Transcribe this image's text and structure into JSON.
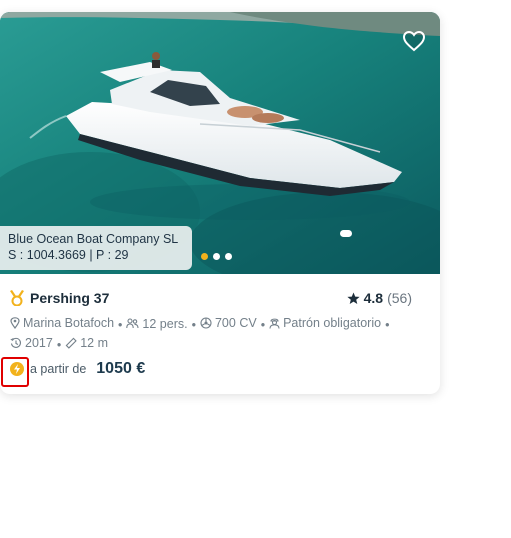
{
  "listing": {
    "company": "Blue Ocean Boat Company SL",
    "company_stats": "S : 1004.3669 | P : 29",
    "boat_name": "Pershing 37",
    "rating": "4.8",
    "rating_count": "(56)",
    "location": "Marina Botafoch",
    "capacity": "12 pers.",
    "power": "700 CV",
    "skipper": "Patrón obligatorio",
    "year": "2017",
    "length": "12 m",
    "price_prefix": "a partir de",
    "price": "1050 €"
  },
  "carousel": {
    "slides": 3,
    "active_index": 0
  },
  "icons": {
    "favorite": "heart-outline-icon",
    "medal": "medal-icon",
    "star": "star-icon",
    "location": "map-pin-icon",
    "capacity": "people-icon",
    "power": "engine-icon",
    "skipper": "captain-icon",
    "year": "calendar-icon",
    "length": "ruler-icon",
    "instant": "lightning-icon"
  },
  "colors": {
    "accent": "#f2b21c",
    "text_dark": "#1d2e3b",
    "text_muted": "#74808a",
    "highlight": "#e00000"
  }
}
